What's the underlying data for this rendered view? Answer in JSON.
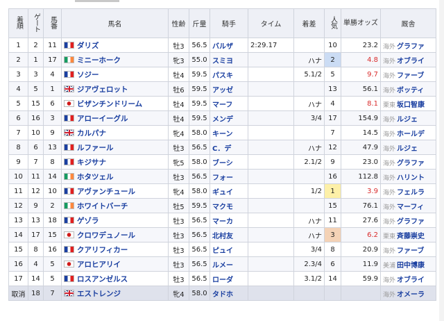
{
  "headers": {
    "finish": "着順",
    "gate": "ゲート",
    "number": "馬番",
    "horse": "馬名",
    "sex_age": "性齢",
    "weight": "斤量",
    "jockey": "騎手",
    "time": "タイム",
    "margin": "着差",
    "popularity": "人気",
    "odds": "単勝オッズ",
    "trainer": "厩舎"
  },
  "rows": [
    {
      "finish": "1",
      "gate": "2",
      "num": "11",
      "flag": "fr",
      "horse": "ダリズ",
      "sex": "牡3",
      "wt": "56.5",
      "jockey": "バルザ",
      "time": "2:29.17",
      "margin": "",
      "pop": "10",
      "odds": "23.2",
      "odds_red": false,
      "region": "海外",
      "trainer": "グラファ",
      "fav": ""
    },
    {
      "finish": "2",
      "gate": "1",
      "num": "17",
      "flag": "ie",
      "horse": "ミニーホーク",
      "sex": "牝3",
      "wt": "55.0",
      "jockey": "スミヨ",
      "time": "",
      "margin": "ハナ",
      "pop": "2",
      "odds": "4.8",
      "odds_red": true,
      "region": "海外",
      "trainer": "オブライ",
      "fav": "2"
    },
    {
      "finish": "3",
      "gate": "3",
      "num": "4",
      "flag": "fr",
      "horse": "ソジー",
      "sex": "牡4",
      "wt": "59.5",
      "jockey": "パスキ",
      "time": "",
      "margin": "5.1/2",
      "pop": "5",
      "odds": "9.7",
      "odds_red": true,
      "region": "海外",
      "trainer": "ファーブ",
      "fav": ""
    },
    {
      "finish": "4",
      "gate": "5",
      "num": "1",
      "flag": "gb",
      "horse": "ジアヴェロット",
      "sex": "牡6",
      "wt": "59.5",
      "jockey": "アッゼ",
      "time": "",
      "margin": "",
      "pop": "13",
      "odds": "56.1",
      "odds_red": false,
      "region": "海外",
      "trainer": "ボッティ",
      "fav": ""
    },
    {
      "finish": "5",
      "gate": "15",
      "num": "6",
      "flag": "jp",
      "horse": "ビザンチンドリーム",
      "sex": "牡4",
      "wt": "59.5",
      "jockey": "マーフ",
      "time": "",
      "margin": "ハナ",
      "pop": "4",
      "odds": "8.1",
      "odds_red": true,
      "region": "栗東",
      "trainer": "坂口智康",
      "fav": ""
    },
    {
      "finish": "6",
      "gate": "16",
      "num": "3",
      "flag": "fr",
      "horse": "アローイーグル",
      "sex": "牡4",
      "wt": "59.5",
      "jockey": "メンデ",
      "time": "",
      "margin": "3/4",
      "pop": "17",
      "odds": "154.9",
      "odds_red": false,
      "region": "海外",
      "trainer": "ルジェ",
      "fav": ""
    },
    {
      "finish": "7",
      "gate": "10",
      "num": "9",
      "flag": "gb",
      "horse": "カルパナ",
      "sex": "牝4",
      "wt": "58.0",
      "jockey": "キーン",
      "time": "",
      "margin": "",
      "pop": "7",
      "odds": "14.5",
      "odds_red": false,
      "region": "海外",
      "trainer": "ホールデ",
      "fav": ""
    },
    {
      "finish": "8",
      "gate": "6",
      "num": "13",
      "flag": "fr",
      "horse": "ルファール",
      "sex": "牡3",
      "wt": "56.5",
      "jockey": "C．デ",
      "time": "",
      "margin": "ハナ",
      "pop": "12",
      "odds": "47.9",
      "odds_red": false,
      "region": "海外",
      "trainer": "ルジェ",
      "fav": ""
    },
    {
      "finish": "9",
      "gate": "7",
      "num": "8",
      "flag": "fr",
      "horse": "キジサナ",
      "sex": "牝5",
      "wt": "58.0",
      "jockey": "ブーシ",
      "time": "",
      "margin": "2.1/2",
      "pop": "9",
      "odds": "23.0",
      "odds_red": false,
      "region": "海外",
      "trainer": "グラファ",
      "fav": ""
    },
    {
      "finish": "10",
      "gate": "11",
      "num": "14",
      "flag": "ie",
      "horse": "ホタツェル",
      "sex": "牡3",
      "wt": "56.5",
      "jockey": "フォー",
      "time": "",
      "margin": "",
      "pop": "16",
      "odds": "112.8",
      "odds_red": false,
      "region": "海外",
      "trainer": "ハリント",
      "fav": ""
    },
    {
      "finish": "11",
      "gate": "12",
      "num": "10",
      "flag": "fr",
      "horse": "アヴァンチュール",
      "sex": "牝4",
      "wt": "58.0",
      "jockey": "ギュイ",
      "time": "",
      "margin": "1/2",
      "pop": "1",
      "odds": "3.9",
      "odds_red": true,
      "region": "海外",
      "trainer": "フェルラ",
      "fav": "1"
    },
    {
      "finish": "12",
      "gate": "9",
      "num": "2",
      "flag": "ie",
      "horse": "ホワイトバーチ",
      "sex": "牡5",
      "wt": "59.5",
      "jockey": "マクモ",
      "time": "",
      "margin": "",
      "pop": "15",
      "odds": "76.1",
      "odds_red": false,
      "region": "海外",
      "trainer": "マーフィ",
      "fav": ""
    },
    {
      "finish": "13",
      "gate": "13",
      "num": "18",
      "flag": "fr",
      "horse": "ゲゾラ",
      "sex": "牡3",
      "wt": "56.5",
      "jockey": "マーカ",
      "time": "",
      "margin": "ハナ",
      "pop": "11",
      "odds": "27.6",
      "odds_red": false,
      "region": "海外",
      "trainer": "グラファ",
      "fav": ""
    },
    {
      "finish": "14",
      "gate": "17",
      "num": "15",
      "flag": "jp",
      "horse": "クロワデュノール",
      "sex": "牡3",
      "wt": "56.5",
      "jockey": "北村友",
      "time": "",
      "margin": "ハナ",
      "pop": "3",
      "odds": "6.2",
      "odds_red": true,
      "region": "栗東",
      "trainer": "斉藤崇史",
      "fav": "3"
    },
    {
      "finish": "15",
      "gate": "8",
      "num": "16",
      "flag": "fr",
      "horse": "クアリフィカー",
      "sex": "牡3",
      "wt": "56.5",
      "jockey": "ピュイ",
      "time": "",
      "margin": "3/4",
      "pop": "8",
      "odds": "20.9",
      "odds_red": false,
      "region": "海外",
      "trainer": "ファーブ",
      "fav": ""
    },
    {
      "finish": "16",
      "gate": "4",
      "num": "5",
      "flag": "jp",
      "horse": "アロヒアリイ",
      "sex": "牡3",
      "wt": "56.5",
      "jockey": "ルメー",
      "time": "",
      "margin": "2.3/4",
      "pop": "6",
      "odds": "11.9",
      "odds_red": false,
      "region": "美浦",
      "trainer": "田中博康",
      "fav": ""
    },
    {
      "finish": "17",
      "gate": "14",
      "num": "5",
      "flag": "fr",
      "horse": "ロスアンゼルス",
      "sex": "牡3",
      "wt": "56.5",
      "jockey": "ローダ",
      "time": "",
      "margin": "3.1/2",
      "pop": "14",
      "odds": "59.9",
      "odds_red": false,
      "region": "海外",
      "trainer": "オブライ",
      "fav": ""
    },
    {
      "finish": "取消",
      "gate": "18",
      "num": "7",
      "flag": "gb",
      "horse": "エストレンジ",
      "sex": "牝4",
      "wt": "58.0",
      "jockey": "タドホ",
      "time": "",
      "margin": "",
      "pop": "",
      "odds": "",
      "odds_red": false,
      "region": "海外",
      "trainer": "オメーラ",
      "fav": "",
      "scratch": true
    }
  ]
}
